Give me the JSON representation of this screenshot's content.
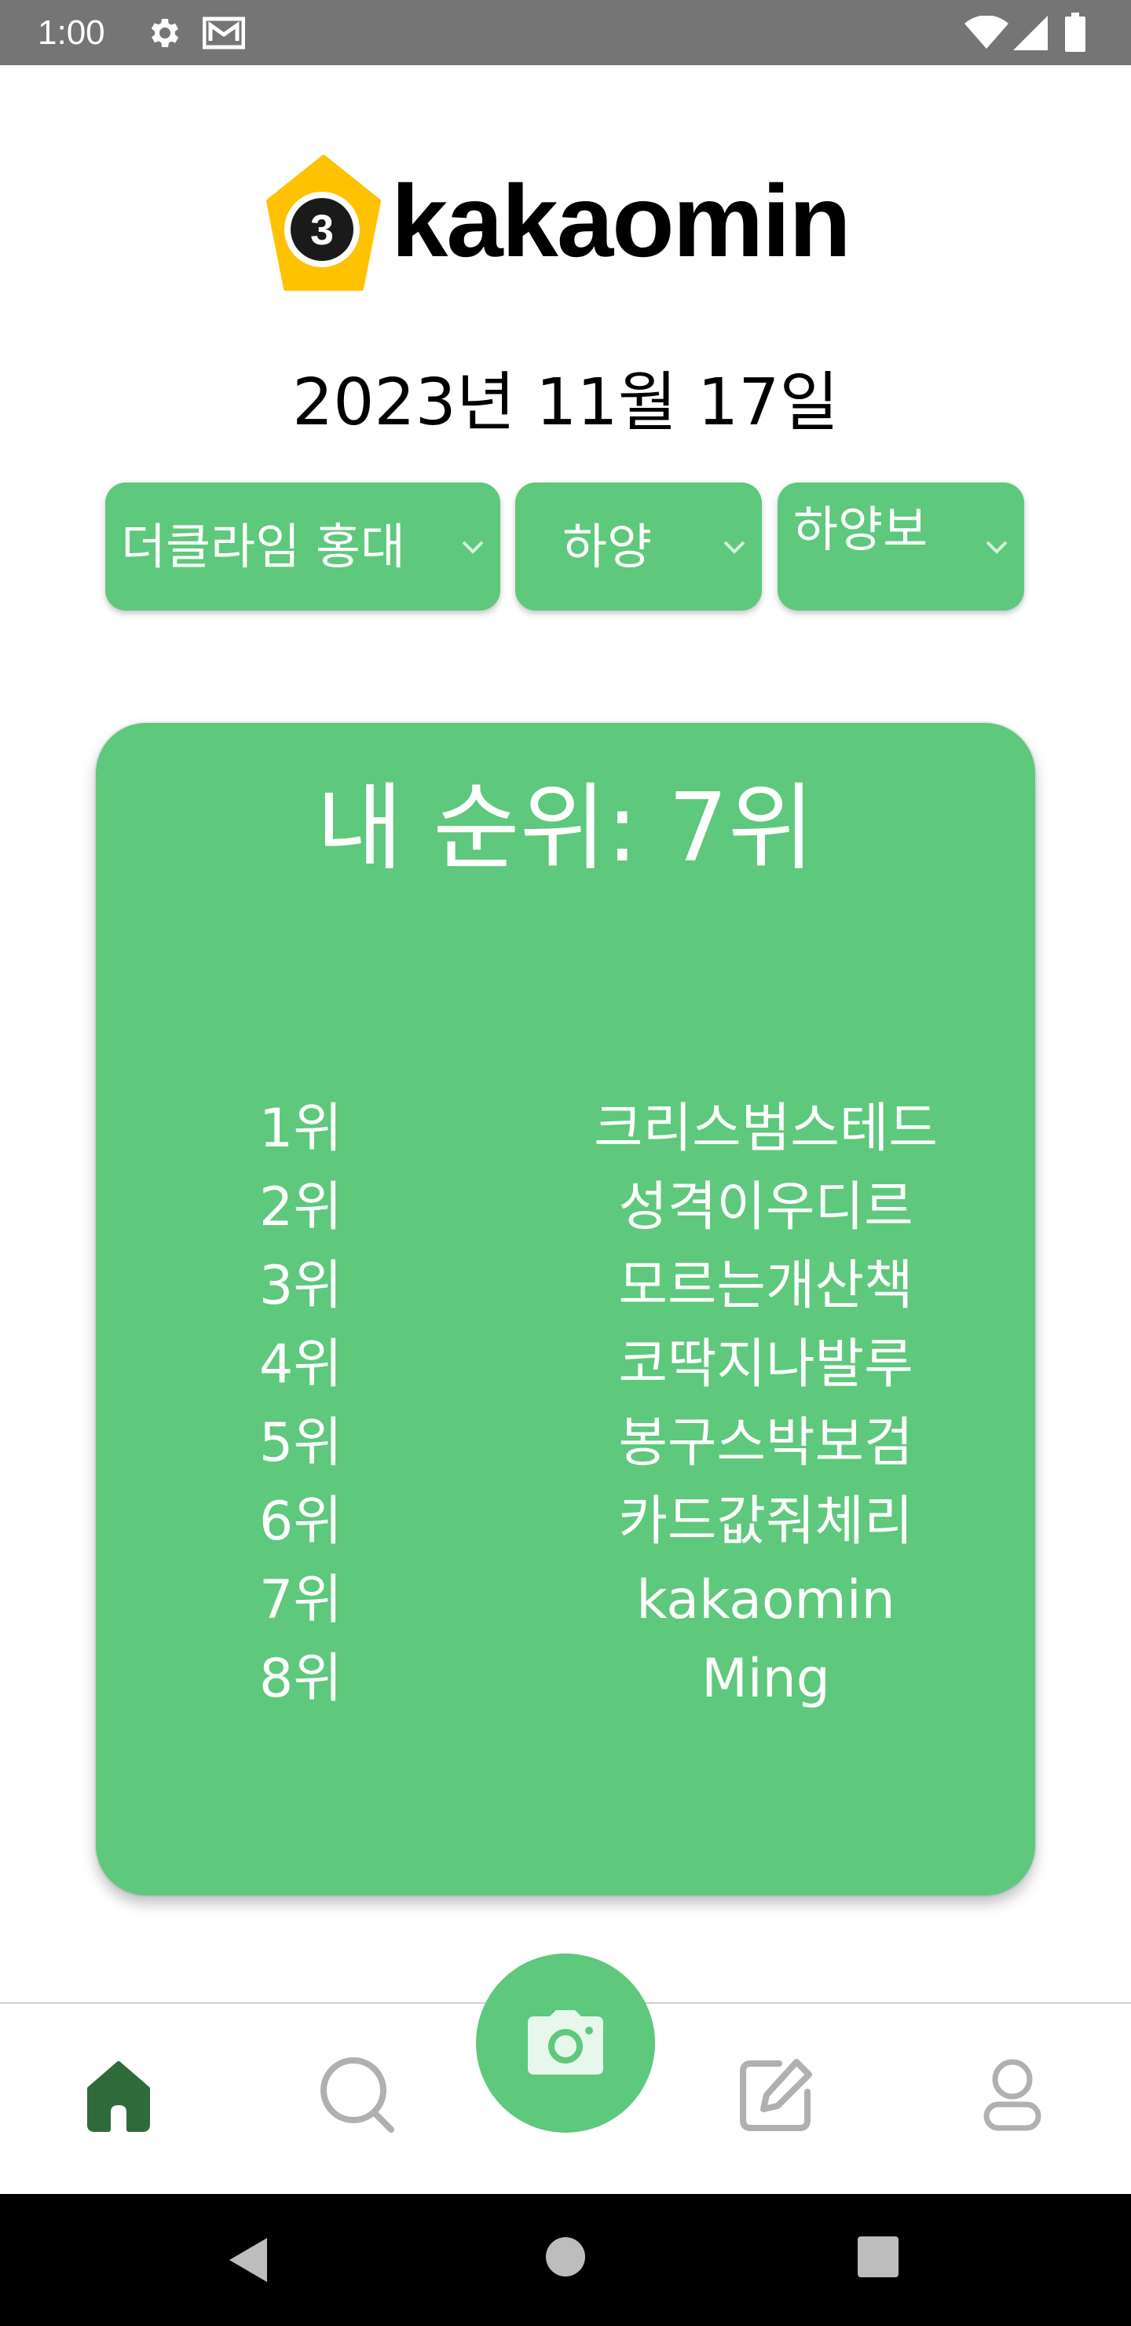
{
  "status_bar": {
    "time": "1:00",
    "icons": [
      "settings-icon",
      "mail-icon",
      "wifi-icon",
      "signal-icon",
      "battery-icon"
    ]
  },
  "logo": {
    "badge_number": "3",
    "text": "kakaomin"
  },
  "date": "2023년 11월 17일",
  "dropdowns": [
    {
      "selected": "더클라임 홍대"
    },
    {
      "selected": "하양"
    },
    {
      "selected": "하양보"
    }
  ],
  "rank_card": {
    "title": "내 순위: 7위",
    "rows": [
      {
        "rank": "1위",
        "name": "크리스범스테드"
      },
      {
        "rank": "2위",
        "name": "성격이우디르"
      },
      {
        "rank": "3위",
        "name": "모르는개산책"
      },
      {
        "rank": "4위",
        "name": "코딱지나발루"
      },
      {
        "rank": "5위",
        "name": "봉구스박보검"
      },
      {
        "rank": "6위",
        "name": "카드값줘체리"
      },
      {
        "rank": "7위",
        "name": "kakaomin"
      },
      {
        "rank": "8위",
        "name": "Ming"
      }
    ]
  },
  "bottom_nav": {
    "items": [
      "home-icon",
      "search-icon",
      "camera-icon",
      "edit-icon",
      "profile-icon"
    ],
    "active": "home-icon"
  },
  "colors": {
    "accent": "#5ec87c",
    "status_bar": "#757575",
    "badge": "#ffc200",
    "nav_active": "#2f6b3a",
    "nav_inactive": "#b0b0b0"
  }
}
